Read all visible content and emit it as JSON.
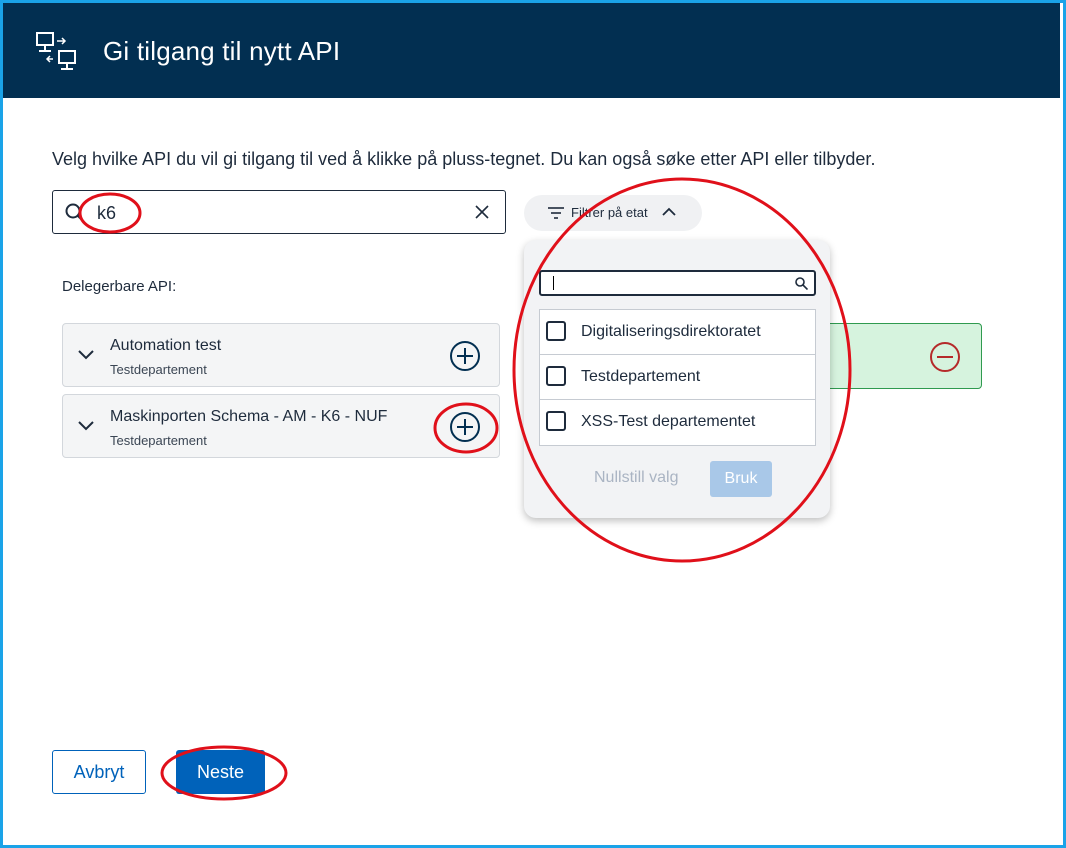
{
  "header": {
    "title": "Gi tilgang til nytt API",
    "icon": "api-network-icon"
  },
  "intro": "Velg hvilke API du vil gi tilgang til ved å klikke på pluss-tegnet. Du kan også søke etter API eller tilbyder.",
  "search": {
    "value": "k6"
  },
  "filter": {
    "label": "Filtrer på etat"
  },
  "section_label": "Delegerbare API:",
  "apis": [
    {
      "name": "Automation test",
      "owner": "Testdepartement"
    },
    {
      "name": "Maskinporten Schema - AM - K6 - NUF",
      "owner": "Testdepartement"
    }
  ],
  "dropdown": {
    "search_value": "",
    "options": [
      "Digitaliseringsdirektoratet",
      "Testdepartement",
      "XSS-Test departementet"
    ],
    "reset_label": "Nullstill valg",
    "apply_label": "Bruk"
  },
  "footer": {
    "cancel_label": "Avbryt",
    "next_label": "Neste"
  },
  "colors": {
    "header_bg": "#022f51",
    "primary": "#0062ba",
    "selected_bg": "#d6f3de",
    "annotation": "#e0101a"
  }
}
